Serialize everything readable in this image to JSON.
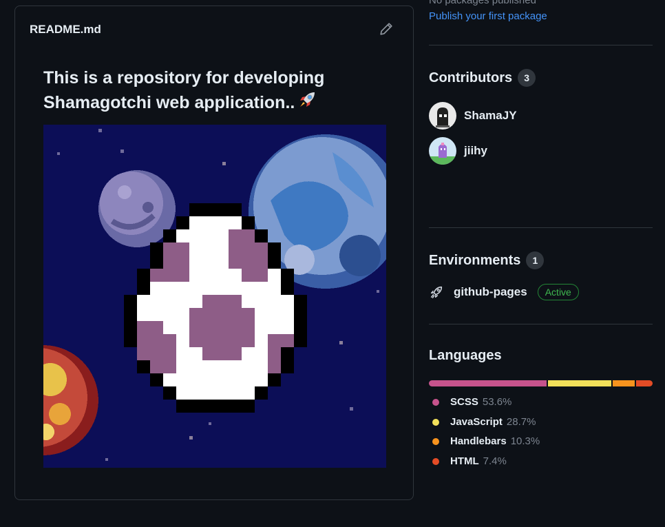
{
  "readme": {
    "title": "README.md",
    "heading": "This is a repository for developing Shamagotchi web application..",
    "heading_emoji": "rocket-emoji"
  },
  "packages": {
    "status": "No packages published",
    "publish_link": "Publish your first package"
  },
  "contributors": {
    "title": "Contributors",
    "count": "3",
    "items": [
      {
        "name": "ShamaJY"
      },
      {
        "name": "jiihy"
      }
    ]
  },
  "environments": {
    "title": "Environments",
    "count": "1",
    "items": [
      {
        "name": "github-pages",
        "status": "Active",
        "icon": "rocket-icon"
      }
    ]
  },
  "languages": {
    "title": "Languages",
    "items": [
      {
        "name": "SCSS",
        "percent": "53.6%",
        "value": 53.6,
        "color": "#c6538c"
      },
      {
        "name": "JavaScript",
        "percent": "28.7%",
        "value": 28.7,
        "color": "#f1e05a"
      },
      {
        "name": "Handlebars",
        "percent": "10.3%",
        "value": 10.3,
        "color": "#f7931e"
      },
      {
        "name": "HTML",
        "percent": "7.4%",
        "value": 7.4,
        "color": "#e34c26"
      }
    ]
  }
}
